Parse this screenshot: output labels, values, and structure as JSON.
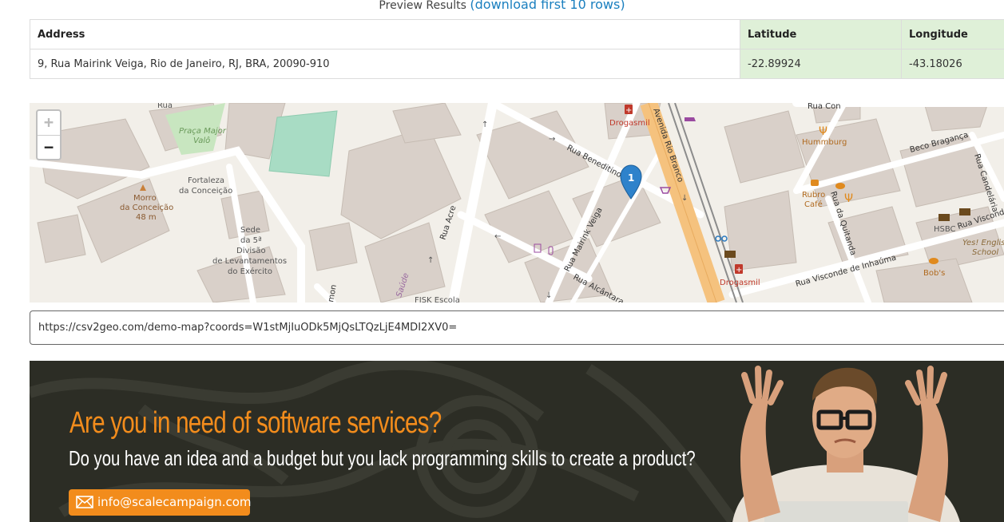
{
  "preview": {
    "label": "Preview Results",
    "paren_open": "(",
    "link": "download first 10 rows",
    "paren_close": ")"
  },
  "table": {
    "headers": [
      "Address",
      "Latitude",
      "Longitude"
    ],
    "rows": [
      [
        "9, Rua Mairink Veiga, Rio de Janeiro, RJ, BRA, 20090-910",
        "-22.89924",
        "-43.18026"
      ]
    ]
  },
  "map": {
    "zoom_in": "+",
    "zoom_out": "−",
    "marker_label": "1",
    "labels": {
      "rua_top": "Rua",
      "praca": "Praça Major",
      "praca2": "Valô",
      "fortaleza": "Fortaleza",
      "fortaleza2": "da Conceição",
      "morro": "Morro",
      "morro2": "da Conceição",
      "morro3": "48 m",
      "sede1": "Sede",
      "sede2": "da 5ª",
      "sede3": "Divisão",
      "sede4": "de Levantamentos",
      "sede5": "do Exército",
      "rua_acre": "Rua Acre",
      "rua_mairink": "Rua Mairink Veiga",
      "rua_benedit": "Rua Beneditinos",
      "rua_alcant": "Rua Alcântara",
      "av_rio": "Avenida Rio Branco",
      "drogasmil1": "Drogasmil",
      "drogasmil2": "Drogasmil",
      "hummburg": "Hummburg",
      "beco": "Beco Bragança",
      "rubro": "Rubro",
      "rubro2": "Café",
      "quitanda": "Rua da Quitanda",
      "candelaria": "Rua Candelária",
      "hsbc": "HSBC",
      "yes1": "Yes! English",
      "yes2": "School",
      "bobs": "Bob's",
      "visconde": "Rua Visconde de Inhaúma",
      "visconde2": "Rua Visconde",
      "rua_con": "Rua Con",
      "saude": "Saúde",
      "fisk": "FISK Escola",
      "mon": "mon"
    }
  },
  "url": {
    "value": "https://csv2geo.com/demo-map?coords=W1stMjIuODk5MjQsLTQzLjE4MDI2XV0="
  },
  "banner": {
    "headline": "Are you in need of software services?",
    "subline": "Do you have an idea and a budget but you lack programming skills to create a product?",
    "email": "info@scalecampaign.com"
  },
  "colors": {
    "accent_orange": "#f28c1c",
    "link_blue": "#1a7fbf",
    "geo_green": "#dff0d8",
    "banner_bg": "#2c2d25"
  }
}
